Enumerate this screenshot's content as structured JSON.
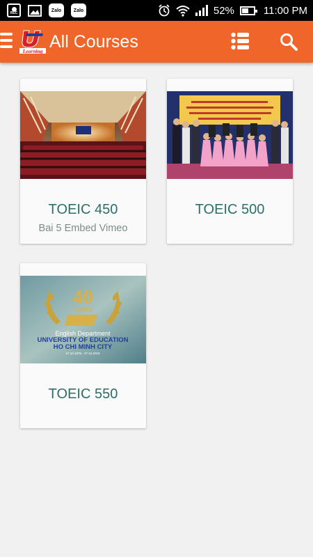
{
  "status_bar": {
    "left_icons": [
      "rec-icon",
      "image-icon",
      "zalo-icon",
      "zalo-icon"
    ],
    "zalo_label": "Zalo",
    "rec_label": "REC",
    "battery": "52%",
    "time": "11:00 PM"
  },
  "app_bar": {
    "logo_text": "Learning",
    "title": "All Courses",
    "color": "#f0652a"
  },
  "courses": [
    {
      "title": "TOEIC 450",
      "subtitle": "Bai 5 Embed Vimeo",
      "image": "auditorium-photo"
    },
    {
      "title": "TOEIC 500",
      "subtitle": "",
      "image": "group-stage-photo"
    },
    {
      "title": "TOEIC 550",
      "subtitle": "",
      "image": "anniversary-banner"
    }
  ],
  "banner": {
    "number": "40",
    "years": "YEARS",
    "line1": "English Department",
    "line2": "UNIVERSITY OF EDUCATION",
    "line3": "HO CHI MINH CITY",
    "dates": "27.10.1976 - 27.10.2016"
  }
}
